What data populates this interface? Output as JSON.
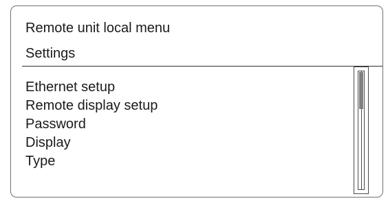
{
  "window": {
    "title": "Remote unit local menu"
  },
  "section": {
    "header": "Settings"
  },
  "menu": {
    "items": [
      {
        "label": "Ethernet setup"
      },
      {
        "label": "Remote display setup"
      },
      {
        "label": "Password"
      },
      {
        "label": "Display"
      },
      {
        "label": "Type"
      }
    ]
  },
  "scrollbar": {
    "position": 0.0,
    "visible_fraction": 0.32
  },
  "colors": {
    "border": "#707070",
    "text": "#1a1a1a",
    "scroll_thumb": "#808080"
  }
}
